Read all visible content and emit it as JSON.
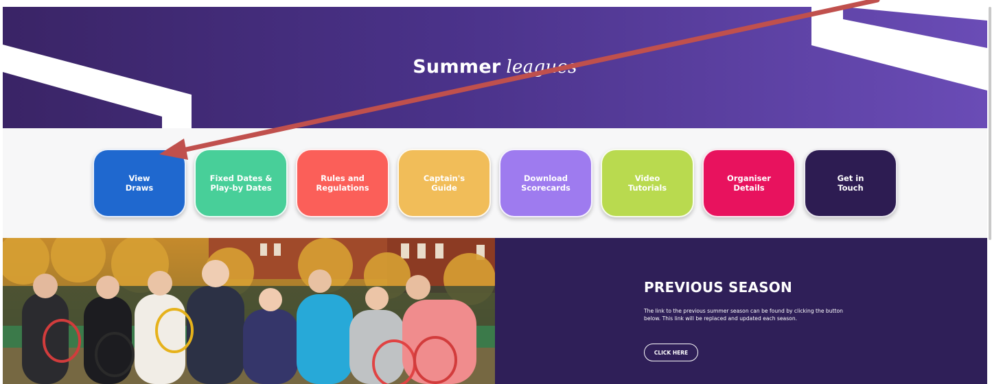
{
  "hero": {
    "title_strong": "Summer",
    "title_script": "leagues"
  },
  "nav_buttons": [
    {
      "label": "View\nDraws",
      "color": "#1f68cf"
    },
    {
      "label": "Fixed Dates &\nPlay-by Dates",
      "color": "#48cf99"
    },
    {
      "label": "Rules and\nRegulations",
      "color": "#fb5f59"
    },
    {
      "label": "Captain's\nGuide",
      "color": "#f1bd59"
    },
    {
      "label": "Download\nScorecards",
      "color": "#9e7bef"
    },
    {
      "label": "Video\nTutorials",
      "color": "#b9da4f"
    },
    {
      "label": "Organiser\nDetails",
      "color": "#e8125e"
    },
    {
      "label": "Get in\nTouch",
      "color": "#2d1c52"
    }
  ],
  "previous_season": {
    "title": "PREVIOUS SEASON",
    "text": "The link to the previous summer season can be found by clicking the button below. This link will be replaced and updated each season.",
    "button_label": "CLICK HERE"
  },
  "colors": {
    "hero_start": "#3a2466",
    "hero_end": "#6a4cb6",
    "season_bg": "#2f1f58",
    "annotation_arrow": "#c0504d"
  }
}
